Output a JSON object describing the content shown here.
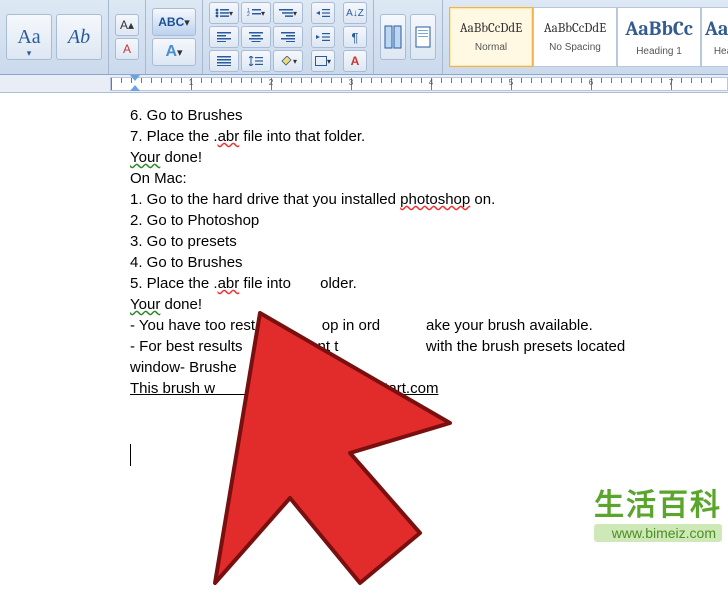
{
  "ribbon": {
    "font_case_Aa": "Aa",
    "font_script": "Ab",
    "wordart_label": "A",
    "clear_fmt": "A",
    "textfx_label": "ABC",
    "list_types": [
      "bullet",
      "numbered",
      "multilevel"
    ],
    "align_left": "≡",
    "align_center": "≡",
    "align_right": "≡",
    "styles": [
      {
        "sample": "AaBbCcDdE",
        "label": "Normal",
        "size": "13px",
        "selected": true
      },
      {
        "sample": "AaBbCcDdE",
        "label": "No Spacing",
        "size": "13px",
        "selected": false
      },
      {
        "sample": "AaBbCc",
        "label": "Heading 1",
        "size": "20px",
        "selected": false
      },
      {
        "sample": "AaB",
        "label": "Hea",
        "size": "20px",
        "selected": false
      }
    ]
  },
  "document": {
    "lines": {
      "l1": "6. Go to Brushes",
      "l2a": "7. Place the .",
      "l2b": "abr",
      "l2c": " file into that folder.",
      "l3": "Your",
      "l3b": " done!",
      "blank1": " ",
      "l4": "On Mac:",
      "l5a": "1. Go to the hard drive that you installed ",
      "l5b": "photoshop",
      "l5c": " on.",
      "l6": "2. Go to Photoshop",
      "l7": "3. Go to presets",
      "l8": "4. Go to Brushes",
      "l9a": "5. Place the .",
      "l9b": "abr",
      "l9c": " file into       older.",
      "l10": "Your",
      "l10b": " done!",
      "l11a": "- You have too resta              op in ord           ake your brush available.",
      "l12a": "- For best results                  nt t                     with the brush presets located",
      "l13": "window- Brushe",
      "blank2": " ",
      "l14a": "This brush w",
      "l14b": "                              deviantart.com"
    }
  },
  "watermark": {
    "cn": "生活百科",
    "url": "www.bimeiz.com"
  }
}
